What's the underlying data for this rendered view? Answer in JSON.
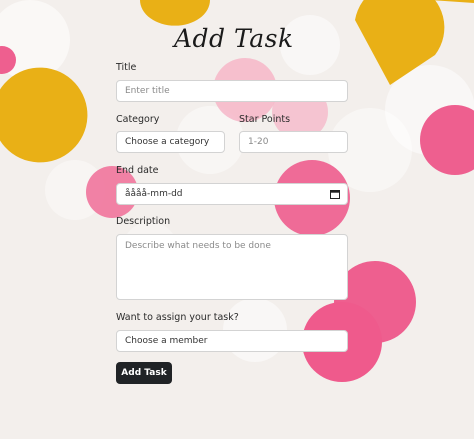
{
  "form": {
    "heading": "Add Task",
    "title": {
      "label": "Title",
      "placeholder": "Enter title"
    },
    "category": {
      "label": "Category",
      "selected": "Choose a category"
    },
    "star_points": {
      "label": "Star Points",
      "placeholder": "1-20"
    },
    "end_date": {
      "label": "End date",
      "value": "åååå-mm-dd"
    },
    "description": {
      "label": "Description",
      "placeholder": "Describe what needs to be done"
    },
    "assign": {
      "label": "Want to assign your task?",
      "selected": "Choose a member"
    },
    "submit_label": "Add Task"
  },
  "colors": {
    "background": "#f3efec",
    "confetti_yellow": "#e9b016",
    "confetti_pink": "#ee5f8f",
    "confetti_light_pink": "#f6b6c8",
    "button": "#202326"
  },
  "icons": {
    "date_picker": "calendar-icon"
  }
}
